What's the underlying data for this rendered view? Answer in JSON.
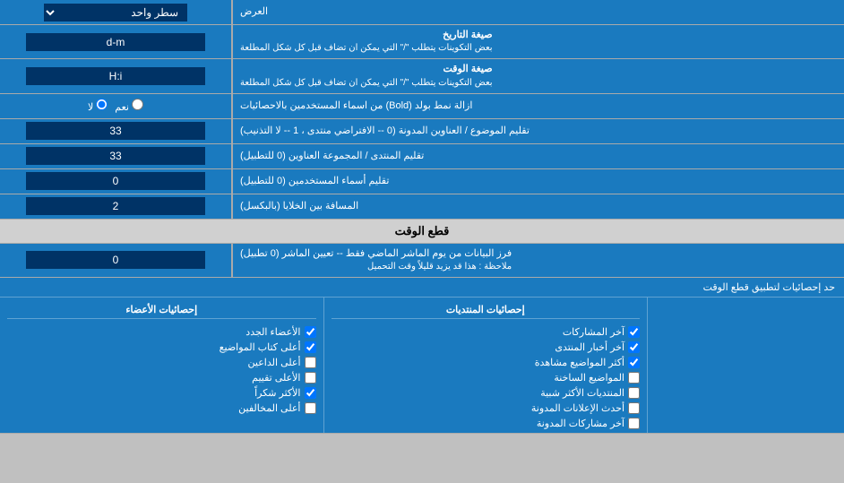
{
  "header": {
    "display_label": "العرض",
    "display_option_label": "سطر واحد"
  },
  "date_format": {
    "label": "صيغة التاريخ",
    "sublabel": "بعض التكوينات يتطلب \"/\" التي يمكن ان تضاف قبل كل شكل المطلعة",
    "value": "d-m"
  },
  "time_format": {
    "label": "صيغة الوقت",
    "sublabel": "بعض التكوينات يتطلب \"/\" التي يمكن ان تضاف قبل كل شكل المطلعة",
    "value": "H:i"
  },
  "bold_remove": {
    "label": "ازالة نمط بولد (Bold) من اسماء المستخدمين بالاحصائيات",
    "radio_yes": "نعم",
    "radio_no": "لا",
    "selected": "no"
  },
  "topic_order": {
    "label": "تقليم الموضوع / العناوين المدونة (0 -- الافتراضي منتدى ، 1 -- لا التذنيب)",
    "value": "33"
  },
  "forum_order": {
    "label": "تقليم المنتدى / المجموعة العناوين (0 للتطبيل)",
    "value": "33"
  },
  "username_trim": {
    "label": "تقليم أسماء المستخدمين (0 للتطبيل)",
    "value": "0"
  },
  "cell_padding": {
    "label": "المسافة بين الخلايا (بالبكسل)",
    "value": "2"
  },
  "realtime_section": {
    "header": "قطع الوقت"
  },
  "realtime_filter": {
    "label": "فرز البيانات من يوم الماشر الماضي فقط -- تعيين الماشر (0 تطبيل)",
    "sublabel": "ملاحظة : هذا قد يزيد قليلاً وقت التحميل",
    "value": "0"
  },
  "stats_limit": {
    "label": "حد إحصائيات لتطبيق قطع الوقت"
  },
  "col1_header": "إحصائيات المنتديات",
  "col2_header": "إحصائيات الأعضاء",
  "col3_header": "",
  "checkboxes": {
    "col1": [
      {
        "label": "آخر المشاركات",
        "checked": true
      },
      {
        "label": "آخر أخبار المنتدى",
        "checked": true
      },
      {
        "label": "أكثر المواضيع مشاهدة",
        "checked": true
      },
      {
        "label": "المواضيع الساخنة",
        "checked": false
      },
      {
        "label": "المنتديات الأكثر شبية",
        "checked": false
      },
      {
        "label": "أحدث الإعلانات المدونة",
        "checked": false
      },
      {
        "label": "آخر مشاركات المدونة",
        "checked": false
      }
    ],
    "col2": [
      {
        "label": "الأعضاء الجدد",
        "checked": true
      },
      {
        "label": "أعلى كتاب المواضيع",
        "checked": true
      },
      {
        "label": "أعلى الداعين",
        "checked": false
      },
      {
        "label": "الأعلى تقييم",
        "checked": false
      },
      {
        "label": "الأكثر شكراً",
        "checked": true
      },
      {
        "label": "أعلى المخالفين",
        "checked": false
      }
    ],
    "col2_header_text": "إحصائيات الأعضاء",
    "col1_header_text": "إحصائيات المنتديات"
  }
}
